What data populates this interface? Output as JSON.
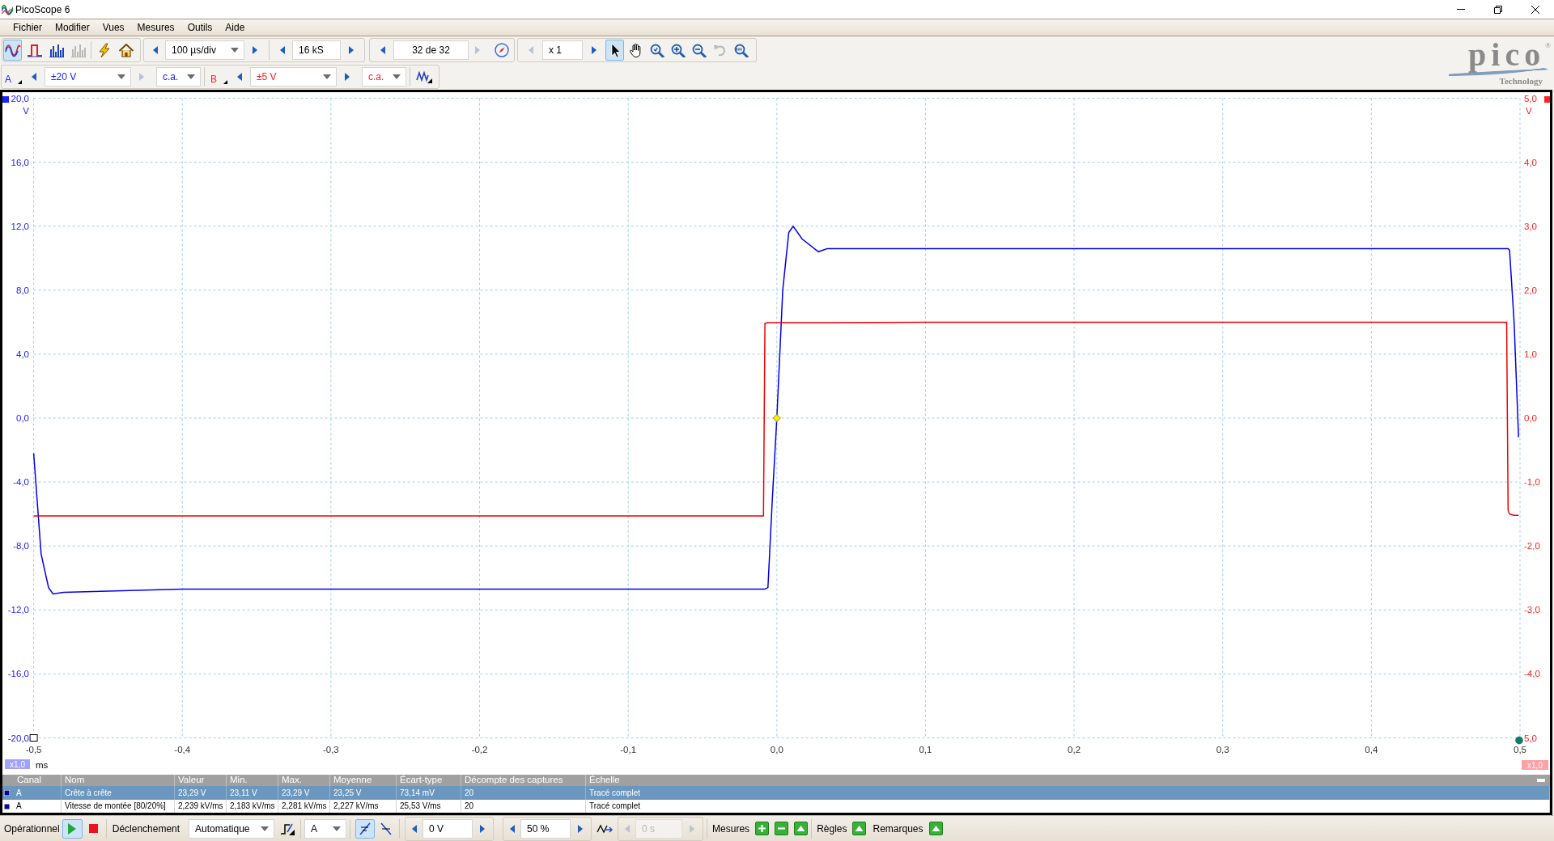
{
  "window": {
    "title": "PicoScope 6"
  },
  "menu": [
    "Fichier",
    "Modifier",
    "Vues",
    "Mesures",
    "Outils",
    "Aide"
  ],
  "toolbar": {
    "view_buttons": [
      {
        "kind": "scope",
        "selected": true,
        "disabled": false
      },
      {
        "kind": "persistence",
        "selected": false,
        "disabled": false
      },
      {
        "kind": "spectrum",
        "selected": false,
        "disabled": false
      },
      {
        "kind": "spectrum",
        "selected": false,
        "disabled": true
      }
    ],
    "actions": [
      {
        "kind": "lightning"
      },
      {
        "kind": "home"
      }
    ],
    "timebase": {
      "value": "100 µs/div"
    },
    "samples": {
      "value": "16 kS"
    },
    "buffer": {
      "value": "32 de 32",
      "prev_disabled": false,
      "next_disabled": true
    },
    "zoom": {
      "value": "x 1",
      "prev_disabled": true,
      "next_disabled": false
    },
    "tools": [
      {
        "kind": "pointer",
        "selected": true,
        "disabled": false
      },
      {
        "kind": "hand",
        "selected": false,
        "disabled": false
      },
      {
        "kind": "zoom",
        "selected": false,
        "disabled": false
      },
      {
        "kind": "zoom-in",
        "selected": false,
        "disabled": false
      },
      {
        "kind": "zoom-out",
        "selected": false,
        "disabled": false
      },
      {
        "kind": "undo",
        "selected": false,
        "disabled": true
      },
      {
        "kind": "zoom-fit",
        "selected": false,
        "disabled": false
      }
    ]
  },
  "channels": [
    {
      "label": "A",
      "color": "#2020ff",
      "range": "±20 V",
      "coupling": "c.a.",
      "prev_disabled": false,
      "next_disabled": true
    },
    {
      "label": "B",
      "color": "#ff2020",
      "range": "±5 V",
      "coupling": "c.a.",
      "prev_disabled": false,
      "next_disabled": false
    }
  ],
  "logo": {
    "name": "pico",
    "mark": "®",
    "tagline": "Technology"
  },
  "plot": {
    "chart_data": {
      "type": "line",
      "grid": true,
      "xlabel": "ms",
      "ylabel": "V",
      "y2label": "V",
      "x": [
        -0.5,
        -0.495,
        -0.49,
        -0.487,
        -0.48,
        -0.4,
        -0.3,
        -0.2,
        -0.1,
        -0.009,
        -0.008,
        -0.006,
        -0.003,
        0,
        0.004,
        0.008,
        0.011,
        0.017,
        0.028,
        0.034,
        0.1,
        0.2,
        0.3,
        0.4,
        0.491,
        0.492,
        0.493,
        0.496,
        0.499
      ],
      "series": [
        {
          "color": "#0000f0",
          "values": [
            -2.2,
            -8.5,
            -10.6,
            -11.0,
            -10.9,
            -10.7,
            -10.7,
            -10.7,
            -10.7,
            -10.7,
            -10.7,
            -10.6,
            -5.0,
            0.0,
            8.0,
            11.6,
            12.0,
            11.2,
            10.4,
            10.6,
            10.6,
            10.6,
            10.6,
            10.6,
            10.6,
            10.6,
            10.5,
            6.0,
            -1.2
          ]
        },
        {
          "color": "#f00000",
          "axis": "y2",
          "values": [
            -1.53,
            -1.53,
            -1.53,
            -1.53,
            -1.53,
            -1.53,
            -1.53,
            -1.53,
            -1.53,
            -1.53,
            1.48,
            1.49,
            1.49,
            1.49,
            1.49,
            1.49,
            1.49,
            1.49,
            1.49,
            1.49,
            1.5,
            1.5,
            1.5,
            1.5,
            1.5,
            -1.45,
            -1.5,
            -1.52,
            -1.52
          ]
        }
      ],
      "xlim": [
        -0.5,
        0.5
      ],
      "ylim": [
        -20,
        20
      ],
      "y2lim": [
        -5,
        5
      ],
      "xticks": [
        {
          "value": -0.5,
          "label": "-0,5"
        },
        {
          "value": -0.4,
          "label": "-0,4"
        },
        {
          "value": -0.3,
          "label": "-0,3"
        },
        {
          "value": -0.2,
          "label": "-0,2"
        },
        {
          "value": -0.1,
          "label": "-0,1"
        },
        {
          "value": 0,
          "label": "0,0"
        },
        {
          "value": 0.1,
          "label": "0,1"
        },
        {
          "value": 0.2,
          "label": "0,2"
        },
        {
          "value": 0.3,
          "label": "0,3"
        },
        {
          "value": 0.4,
          "label": "0,4"
        },
        {
          "value": 0.5,
          "label": "0,5"
        }
      ],
      "yticks": [
        {
          "value": 20,
          "label": "20,0"
        },
        {
          "value": 16,
          "label": "16,0"
        },
        {
          "value": 12,
          "label": "12,0"
        },
        {
          "value": 8,
          "label": "8,0"
        },
        {
          "value": 4,
          "label": "4,0"
        },
        {
          "value": 0,
          "label": "0,0"
        },
        {
          "value": -4,
          "label": "-4,0"
        },
        {
          "value": -8,
          "label": "-8,0"
        },
        {
          "value": -12,
          "label": "-12,0"
        },
        {
          "value": -16,
          "label": "-16,0"
        },
        {
          "value": -20,
          "label": "-20,0"
        }
      ],
      "y2ticks": [
        {
          "value": 5,
          "label": "5,0"
        },
        {
          "value": 4,
          "label": "4,0"
        },
        {
          "value": 3,
          "label": "3,0"
        },
        {
          "value": 2,
          "label": "2,0"
        },
        {
          "value": 1,
          "label": "1,0"
        },
        {
          "value": 0,
          "label": "0,0"
        },
        {
          "value": -1,
          "label": "-1,0"
        },
        {
          "value": -2,
          "label": "-2,0"
        },
        {
          "value": -3,
          "label": "-3,0"
        },
        {
          "value": -4,
          "label": "-4,0"
        },
        {
          "value": -5,
          "label": "5,0"
        }
      ]
    },
    "scale_badges": [
      {
        "label": "x1,0",
        "color": "#a0a0ff"
      },
      {
        "label": "x1,0",
        "color": "#ffa0a4"
      }
    ]
  },
  "measurements": {
    "columns": [
      "Canal",
      "Nom",
      "Valeur",
      "Min.",
      "Max.",
      "Moyenne",
      "Écart-type",
      "Décompte des captures",
      "Échelle"
    ],
    "rows": [
      {
        "selected": true,
        "cells": [
          "A",
          "Crête à crête",
          "23,29 V",
          "23,11 V",
          "23,29 V",
          "23,25 V",
          "73,14 mV",
          "20",
          "Tracé complet"
        ]
      },
      {
        "selected": false,
        "cells": [
          "A",
          "Vitesse de montée [80/20%]",
          "2,239 kV/ms",
          "2,183 kV/ms",
          "2,281 kV/ms",
          "2,227 kV/ms",
          "25,53 V/ms",
          "20",
          "Tracé complet"
        ]
      }
    ]
  },
  "status_bar": {
    "state": "Opérationnel",
    "running": true,
    "trigger_label": "Déclenchement",
    "trigger_mode": "Automatique",
    "trigger_source": "A",
    "edges": [
      {
        "kind": "rising",
        "selected": true
      },
      {
        "kind": "falling",
        "selected": false
      }
    ],
    "threshold": {
      "value": "0 V",
      "disabled": false
    },
    "pretrigger": {
      "value": "50 %",
      "disabled": false
    },
    "delay": {
      "value": "0 s",
      "disabled": true
    },
    "sections": [
      {
        "label": "Mesures",
        "buttons": [
          {
            "kind": "add"
          },
          {
            "kind": "remove"
          },
          {
            "kind": "expand"
          }
        ]
      },
      {
        "label": "Règles",
        "buttons": [
          {
            "kind": "expand"
          }
        ]
      },
      {
        "label": "Remarques",
        "buttons": [
          {
            "kind": "expand"
          }
        ]
      }
    ]
  }
}
